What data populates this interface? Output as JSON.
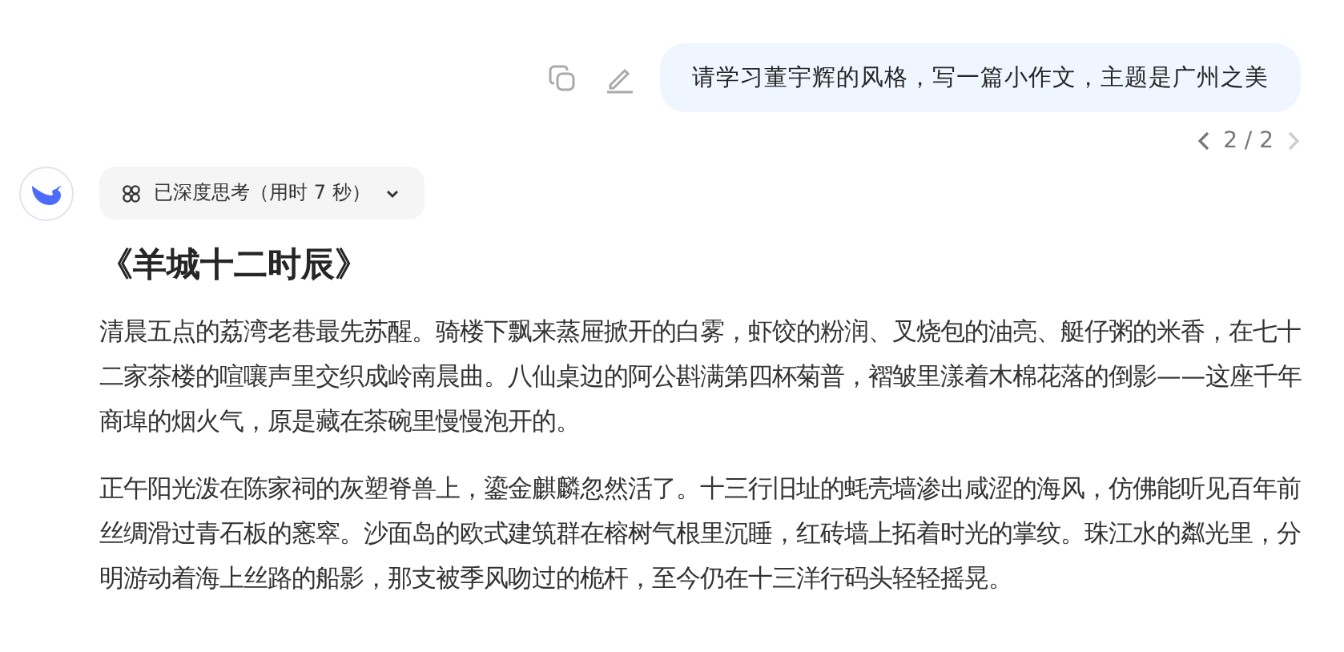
{
  "user_message": {
    "text": "请学习董宇辉的风格，写一篇小作文，主题是广州之美"
  },
  "pager": {
    "text": "2 / 2",
    "prev_disabled": false,
    "next_disabled": true
  },
  "thinking": {
    "label": "已深度思考（用时 7 秒）",
    "expanded": false
  },
  "answer": {
    "title": "《羊城十二时辰》",
    "paragraphs": [
      "清晨五点的荔湾老巷最先苏醒。骑楼下飘来蒸屉掀开的白雾，虾饺的粉润、叉烧包的油亮、艇仔粥的米香，在七十二家茶楼的喧嚷声里交织成岭南晨曲。八仙桌边的阿公斟满第四杯菊普，褶皱里漾着木棉花落的倒影——这座千年商埠的烟火气，原是藏在茶碗里慢慢泡开的。",
      "正午阳光泼在陈家祠的灰塑脊兽上，鎏金麒麟忽然活了。十三行旧址的蚝壳墙渗出咸涩的海风，仿佛能听见百年前丝绸滑过青石板的窸窣。沙面岛的欧式建筑群在榕树气根里沉睡，红砖墙上拓着时光的掌纹。珠江水的粼光里，分明游动着海上丝路的船影，那支被季风吻过的桅杆，至今仍在十三洋行码头轻轻摇晃。"
    ]
  }
}
